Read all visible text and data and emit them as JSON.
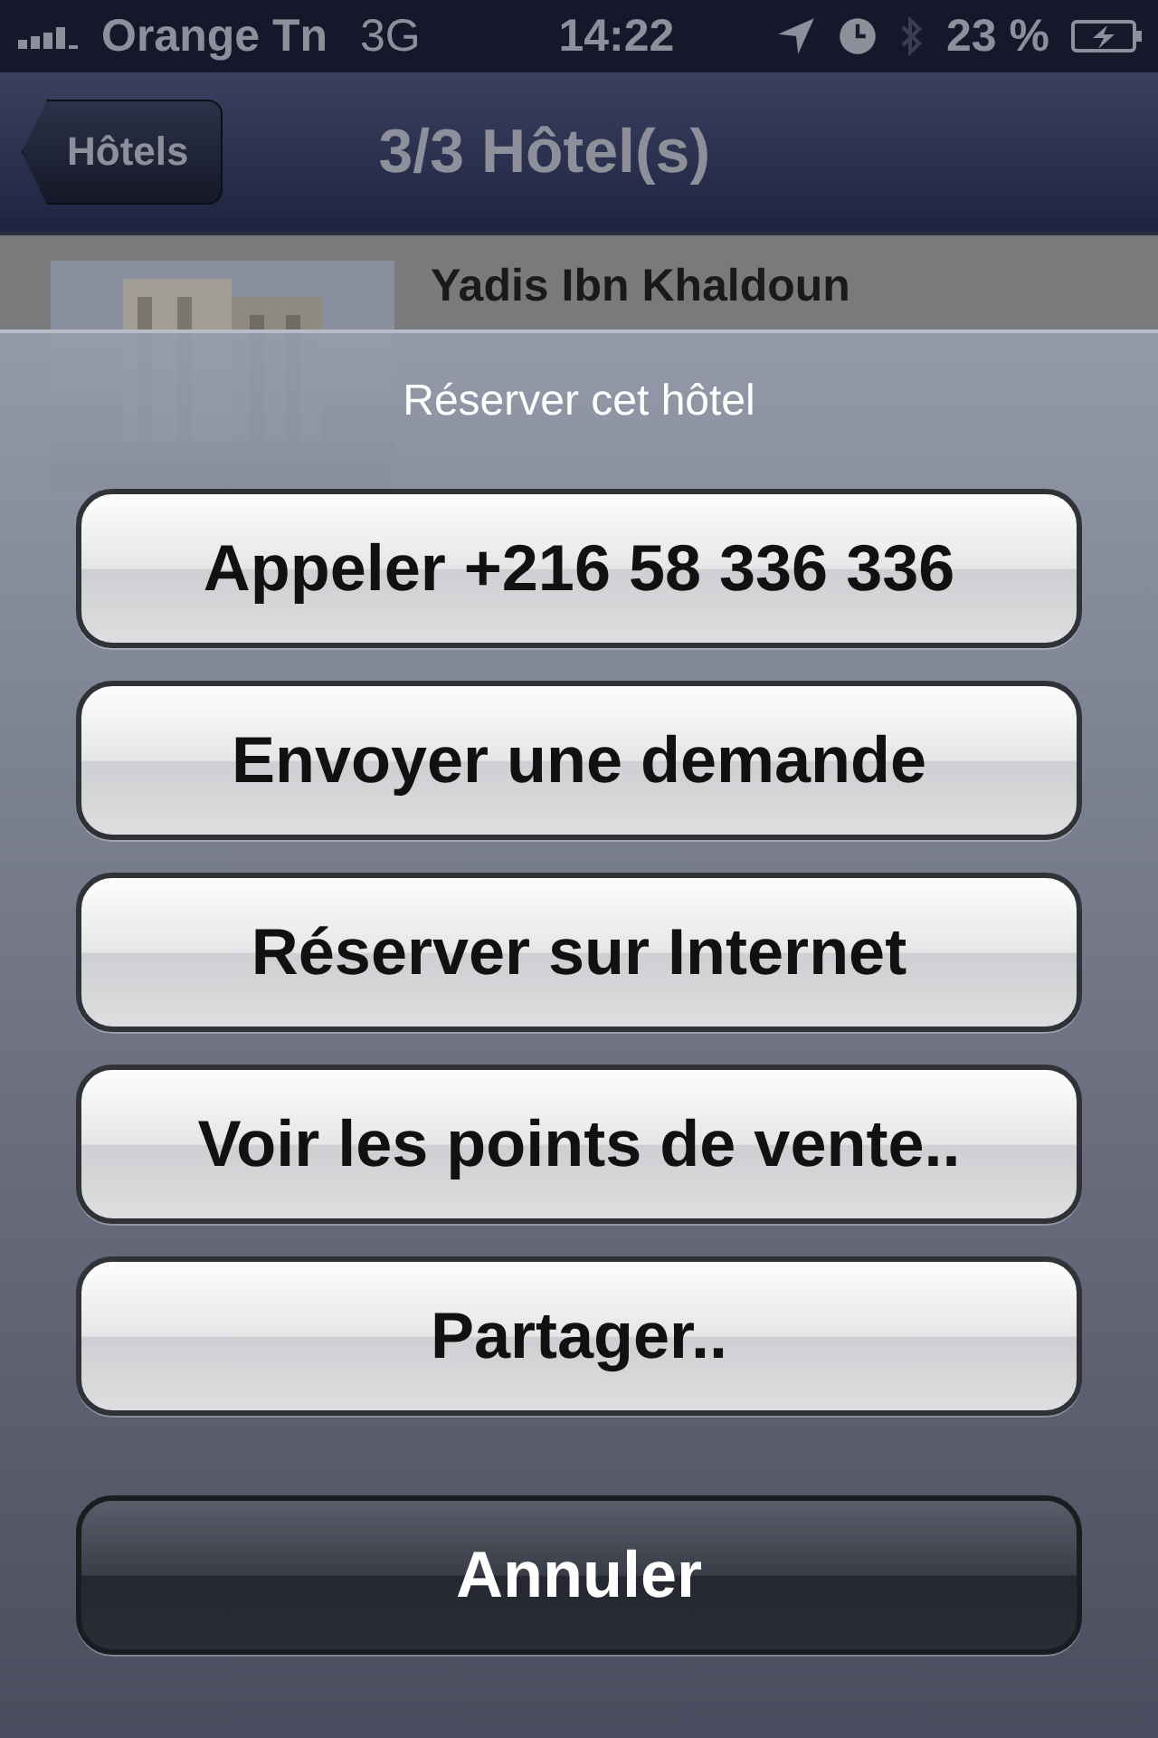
{
  "status_bar": {
    "carrier": "Orange Tn",
    "network": "3G",
    "time": "14:22",
    "battery": "23 %"
  },
  "nav_bar": {
    "back_button": "Hôtels",
    "title": "3/3 Hôtel(s)"
  },
  "hotels": [
    {
      "name": "Yadis Ibn Khaldoun"
    }
  ],
  "action_sheet": {
    "title": "Réserver cet hôtel",
    "buttons": [
      {
        "label": "Appeler +216 58 336 336",
        "kind": "default"
      },
      {
        "label": "Envoyer une demande",
        "kind": "default"
      },
      {
        "label": "Réserver sur Internet",
        "kind": "default"
      },
      {
        "label": "Voir les points de vente..",
        "kind": "default"
      },
      {
        "label": "Partager..",
        "kind": "default"
      },
      {
        "label": "Annuler",
        "kind": "cancel"
      }
    ]
  }
}
